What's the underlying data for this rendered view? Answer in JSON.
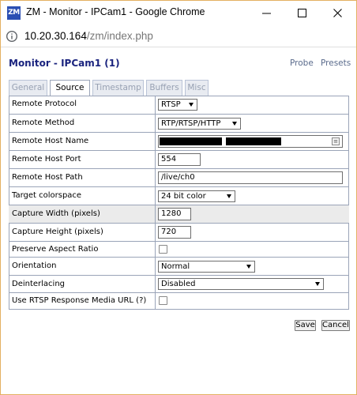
{
  "window": {
    "app_icon_text": "ZM",
    "title": "ZM - Monitor - IPCam1 - Google Chrome"
  },
  "address": {
    "host": "10.20.30.164",
    "path": "/zm/index.php"
  },
  "page": {
    "title": "Monitor - IPCam1 (1)",
    "links": {
      "probe": "Probe",
      "presets": "Presets"
    }
  },
  "tabs": [
    {
      "label": "General",
      "active": false
    },
    {
      "label": "Source",
      "active": true
    },
    {
      "label": "Timestamp",
      "active": false
    },
    {
      "label": "Buffers",
      "active": false
    },
    {
      "label": "Misc",
      "active": false
    }
  ],
  "form": {
    "remote_protocol": {
      "label": "Remote Protocol",
      "value": "RTSP"
    },
    "remote_method": {
      "label": "Remote Method",
      "value": "RTP/RTSP/HTTP"
    },
    "remote_host_name": {
      "label": "Remote Host Name",
      "value": ""
    },
    "remote_host_port": {
      "label": "Remote Host Port",
      "value": "554"
    },
    "remote_host_path": {
      "label": "Remote Host Path",
      "value": "/live/ch0"
    },
    "target_colorspace": {
      "label": "Target colorspace",
      "value": "24 bit color"
    },
    "capture_width": {
      "label": "Capture Width (pixels)",
      "value": "1280"
    },
    "capture_height": {
      "label": "Capture Height (pixels)",
      "value": "720"
    },
    "preserve_aspect": {
      "label": "Preserve Aspect Ratio",
      "checked": false
    },
    "orientation": {
      "label": "Orientation",
      "value": "Normal"
    },
    "deinterlacing": {
      "label": "Deinterlacing",
      "value": "Disabled"
    },
    "rtsp_media_url": {
      "label": "Use RTSP Response Media URL (?)",
      "checked": false
    }
  },
  "buttons": {
    "save": "Save",
    "cancel": "Cancel"
  },
  "colors": {
    "window_border": "#e3b061",
    "title_color": "#1a237e",
    "link_color": "#5a6b8c",
    "table_border": "#9aa4b8",
    "shaded_row": "#ebebeb"
  }
}
